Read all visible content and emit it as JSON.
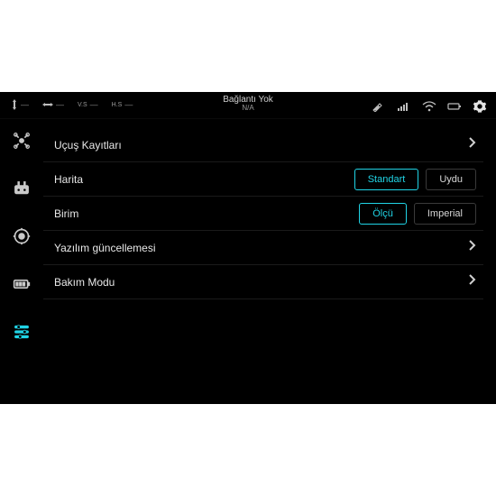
{
  "header": {
    "title": "Bağlantı Yok",
    "subtitle": "N/A",
    "indicator_dash": "—"
  },
  "sidebar": {
    "items": [
      {
        "name": "drone"
      },
      {
        "name": "remote"
      },
      {
        "name": "gimbal"
      },
      {
        "name": "battery"
      },
      {
        "name": "sliders",
        "active": true
      }
    ]
  },
  "list": {
    "flight_records": {
      "label": "Uçuş Kayıtları"
    },
    "map": {
      "label": "Harita",
      "options": {
        "standard": "Standart",
        "satellite": "Uydu"
      },
      "selected": "standard"
    },
    "unit": {
      "label": "Birim",
      "options": {
        "metric": "Ölçü",
        "imperial": "Imperial"
      },
      "selected": "metric"
    },
    "software_update": {
      "label": "Yazılım güncellemesi"
    },
    "maintenance": {
      "label": "Bakım Modu"
    }
  },
  "colors": {
    "accent": "#20d4e6"
  }
}
